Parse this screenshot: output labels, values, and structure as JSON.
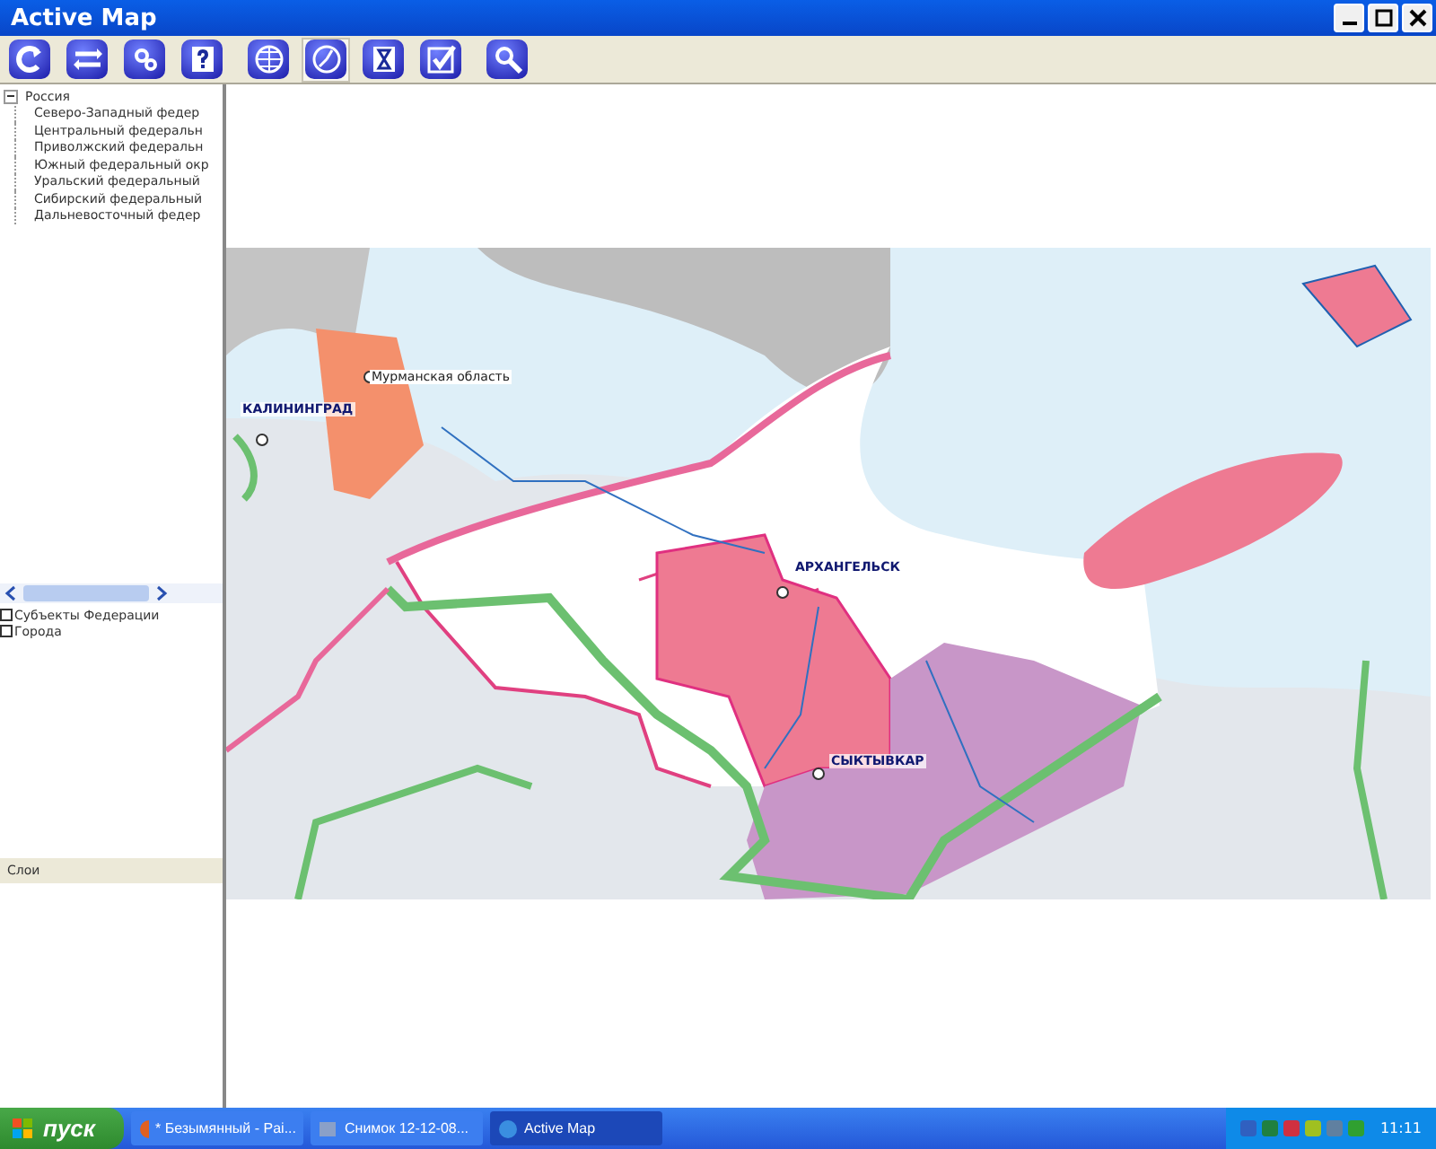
{
  "window": {
    "title": "Active Map"
  },
  "toolbar": {
    "groups": [
      [
        {
          "selected": false
        },
        {
          "selected": false
        },
        {
          "selected": false
        },
        {
          "selected": false
        }
      ],
      [
        {
          "selected": false
        },
        {
          "selected": true
        },
        {
          "selected": false
        },
        {
          "selected": false
        }
      ],
      [
        {
          "selected": false
        }
      ]
    ]
  },
  "tree": {
    "label": "Россия",
    "expanded": true,
    "children": [
      {
        "label": "Северо-Западный федер"
      },
      {
        "label": "Центральный федеральн"
      },
      {
        "label": "Приволжский федеральн"
      },
      {
        "label": "Южный федеральный окр"
      },
      {
        "label": "Уральский федеральный"
      },
      {
        "label": "Сибирский федеральный"
      },
      {
        "label": "Дальневосточный федер"
      }
    ]
  },
  "layers": [
    {
      "label": "Субъекты Федерации",
      "checked": false
    },
    {
      "label": "Города",
      "checked": false
    }
  ],
  "layers_panel": {
    "title": "Слои"
  },
  "map": {
    "labels": [
      {
        "text": "Мурманская область",
        "kind": "region"
      },
      {
        "text": "КАЛИНИНГРАД",
        "kind": "city"
      },
      {
        "text": "АРХАНГЕЛЬСК",
        "kind": "city"
      },
      {
        "text": "СЫКТЫВКАР",
        "kind": "city"
      }
    ]
  },
  "taskbar": {
    "start": "пуск",
    "items": [
      {
        "label": "* Безымянный - Pai...",
        "selected": false
      },
      {
        "label": "Снимок 12-12-08...",
        "selected": false
      },
      {
        "label": "Active Map",
        "selected": true
      }
    ],
    "clock": "11:11"
  }
}
